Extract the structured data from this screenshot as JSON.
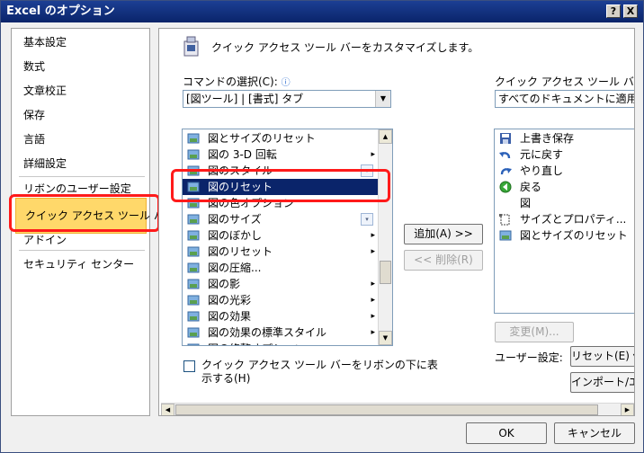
{
  "window": {
    "title": "Excel のオプション",
    "help_label": "?",
    "close_label": "X"
  },
  "nav": {
    "items": [
      {
        "label": "基本設定"
      },
      {
        "label": "数式"
      },
      {
        "label": "文章校正"
      },
      {
        "label": "保存"
      },
      {
        "label": "言語"
      },
      {
        "label": "詳細設定"
      },
      {
        "label": "リボンのユーザー設定"
      },
      {
        "label": "クイック アクセス ツール バー"
      },
      {
        "label": "アドイン"
      },
      {
        "label": "セキュリティ センター"
      }
    ],
    "selected_index": 7
  },
  "main": {
    "header_text": "クイック アクセス ツール バーをカスタマイズします。",
    "choose_commands_label": "コマンドの選択(C):",
    "info_glyph": "ⓘ",
    "choose_commands_value": "[図ツール] | [書式] タブ",
    "customize_label": "クイック アクセス ツール バーのユー",
    "customize_value": "すべてのドキュメントに適用 (既定",
    "commands": [
      {
        "label": "図とサイズのリセット",
        "icon": "reset-size-icon",
        "submenu": false,
        "dropdown": false
      },
      {
        "label": "図の 3-D 回転",
        "icon": "3d-rotation-icon",
        "submenu": true,
        "dropdown": false
      },
      {
        "label": "図のスタイル",
        "icon": "picture-style-icon",
        "submenu": false,
        "dropdown": true
      },
      {
        "label": "図のリセット",
        "icon": "reset-picture-icon",
        "submenu": false,
        "dropdown": false
      },
      {
        "label": "図の色オプション",
        "icon": "color-options-icon",
        "submenu": false,
        "dropdown": false
      },
      {
        "label": "図のサイズ",
        "icon": "picture-size-icon",
        "submenu": false,
        "dropdown": true
      },
      {
        "label": "図のぼかし",
        "icon": "blur-icon",
        "submenu": true,
        "dropdown": false
      },
      {
        "label": "図のリセット",
        "icon": "reset-picture-icon",
        "submenu": true,
        "dropdown": false
      },
      {
        "label": "図の圧縮...",
        "icon": "compress-icon",
        "submenu": false,
        "dropdown": false
      },
      {
        "label": "図の影",
        "icon": "shadow-icon",
        "submenu": true,
        "dropdown": false
      },
      {
        "label": "図の光彩",
        "icon": "glow-icon",
        "submenu": true,
        "dropdown": false
      },
      {
        "label": "図の効果",
        "icon": "effects-icon",
        "submenu": true,
        "dropdown": false
      },
      {
        "label": "図の効果の標準スタイル",
        "icon": "preset-effects-icon",
        "submenu": true,
        "dropdown": false
      },
      {
        "label": "図の修整オプション",
        "icon": "correction-icon",
        "submenu": false,
        "dropdown": false
      }
    ],
    "commands_selected_index": 3,
    "submenu_glyph": "▸",
    "dropdown_glyph": "▾",
    "qat_items": [
      {
        "label": "上書き保存",
        "icon": "save-icon"
      },
      {
        "label": "元に戻す",
        "icon": "undo-icon"
      },
      {
        "label": "やり直し",
        "icon": "redo-icon"
      },
      {
        "label": "戻る",
        "icon": "back-icon"
      },
      {
        "label": "図",
        "icon": ""
      },
      {
        "label": "サイズとプロパティ...",
        "icon": "size-properties-icon"
      },
      {
        "label": "図とサイズのリセット",
        "icon": "reset-size-icon"
      }
    ],
    "add_button": "追加(A) >>",
    "remove_button": "<< 削除(R)",
    "modify_button": "変更(M)...",
    "user_settings_label": "ユーザー設定:",
    "reset_button": "リセット(E) ▾",
    "import_export_button": "インポート/エク",
    "show_below_ribbon_line1": "クイック アクセス ツール バーをリボンの下に表",
    "show_below_ribbon_line2": "示する(H)",
    "show_below_ribbon_checked": false
  },
  "footer": {
    "ok_button": "OK",
    "cancel_button": "キャンセル"
  },
  "colors": {
    "title_bar": "#0a246a",
    "selection": "#0a246a",
    "nav_selected": "#ffd86a",
    "highlight_annotation": "#ff1a1a"
  }
}
